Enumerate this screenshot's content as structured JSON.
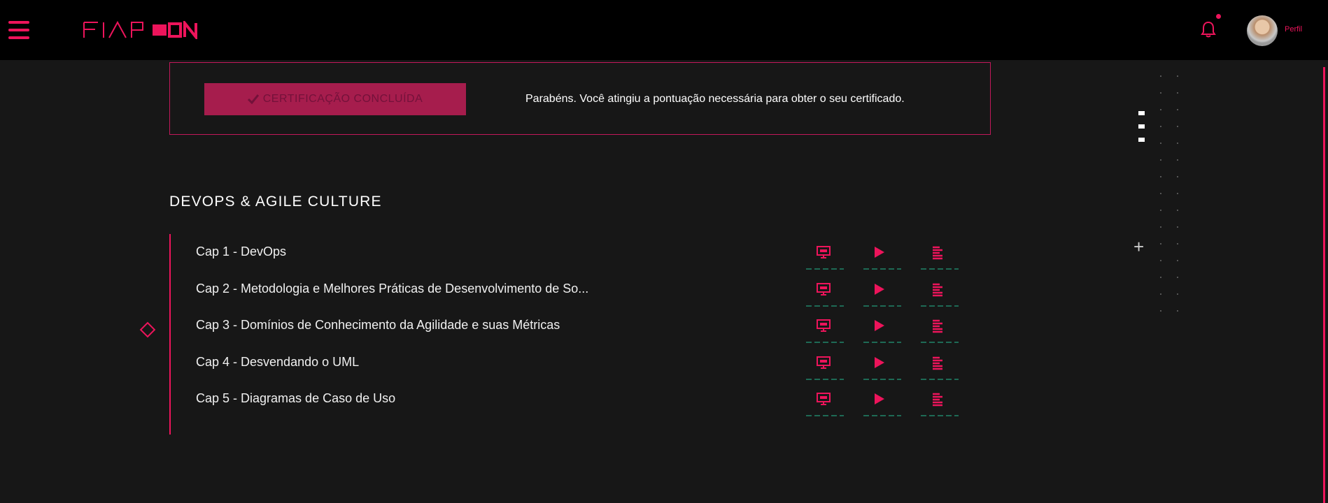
{
  "header": {
    "logo_main": "FIAP",
    "logo_badge": "ON",
    "profile_label": "Perfil",
    "menu_icon": "hamburger-menu-icon",
    "notification_icon": "bell-icon"
  },
  "certification": {
    "button_label": "CERTIFICAÇÃO CONCLUÍDA",
    "button_icon": "checkmark-icon",
    "message": "Parabéns. Você atingiu a pontuação necessária para obter o seu certificado."
  },
  "course": {
    "title": "DEVOPS & AGILE CULTURE",
    "chapters": [
      {
        "label": "Cap 1 - DevOps"
      },
      {
        "label": "Cap 2 - Metodologia e Melhores Práticas de Desenvolvimento de So..."
      },
      {
        "label": "Cap 3 - Domínios de Conhecimento da Agilidade e suas Métricas"
      },
      {
        "label": "Cap 4 - Desvendando o UML"
      },
      {
        "label": "Cap 5 - Diagramas de Caso de Uso"
      }
    ],
    "actions": [
      "presentation-icon",
      "play-icon",
      "text-lines-icon"
    ]
  },
  "colors": {
    "accent": "#ed145b",
    "background": "#171717",
    "header": "#000000",
    "progress": "#1e6a55"
  }
}
